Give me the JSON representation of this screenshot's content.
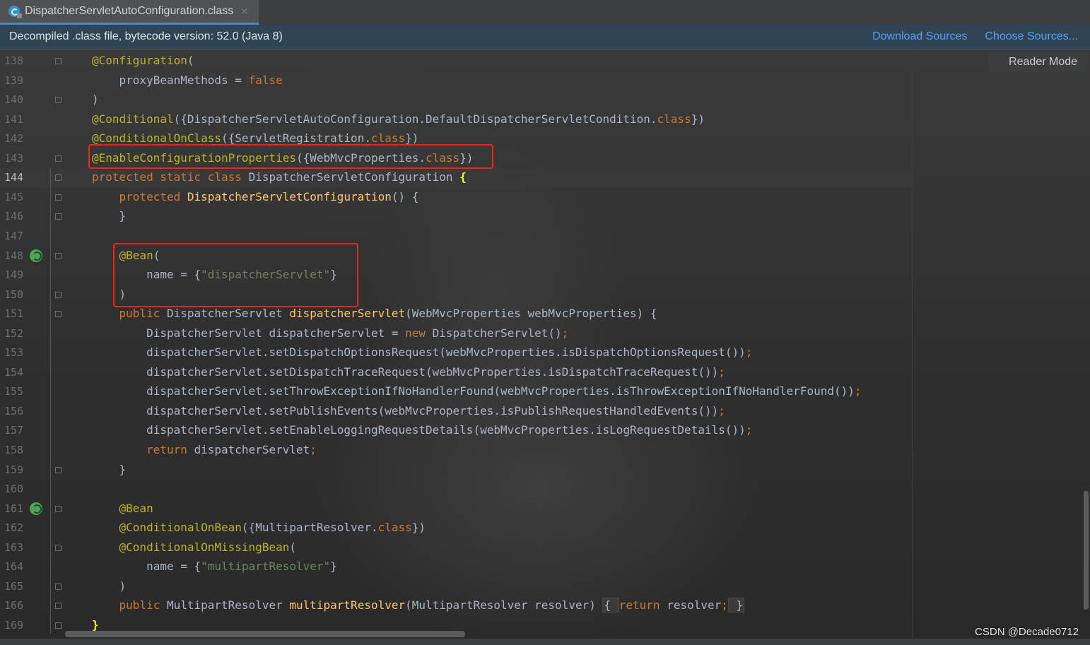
{
  "tab": {
    "title": "DispatcherServletAutoConfiguration.class",
    "close": "×",
    "icon": "java-class-icon"
  },
  "banner": {
    "message": "Decompiled .class file, bytecode version: 52.0 (Java 8)",
    "download_sources": "Download Sources",
    "choose_sources": "Choose Sources..."
  },
  "reader_mode": "Reader Mode",
  "watermark": "CSDN @Decade0712",
  "colors": {
    "annotation": "#bbb529",
    "keyword": "#cc7832",
    "string": "#6a8759",
    "function": "#ffc66d",
    "plain": "#a9b7c6",
    "highlight_box": "#e8261f"
  },
  "editor": {
    "current_line": "144",
    "line_numbers": [
      "138",
      "139",
      "140",
      "141",
      "142",
      "143",
      "144",
      "145",
      "146",
      "147",
      "148",
      "149",
      "150",
      "151",
      "152",
      "153",
      "154",
      "155",
      "156",
      "157",
      "158",
      "159",
      "160",
      "161",
      "162",
      "163",
      "164",
      "165",
      "166",
      "169"
    ],
    "lines": [
      [
        {
          "t": "@Configuration",
          "c": "ann"
        },
        {
          "t": "(",
          "c": "pl"
        }
      ],
      [
        {
          "t": "    proxyBeanMethods = ",
          "c": "pl"
        },
        {
          "t": "false",
          "c": "kw"
        }
      ],
      [
        {
          "t": ")",
          "c": "pl"
        }
      ],
      [
        {
          "t": "@Conditional",
          "c": "ann"
        },
        {
          "t": "({DispatcherServletAutoConfiguration.DefaultDispatcherServletCondition.",
          "c": "pl"
        },
        {
          "t": "class",
          "c": "kw"
        },
        {
          "t": "})",
          "c": "pl"
        }
      ],
      [
        {
          "t": "@ConditionalOnClass",
          "c": "ann"
        },
        {
          "t": "({ServletRegistration.",
          "c": "pl"
        },
        {
          "t": "class",
          "c": "kw"
        },
        {
          "t": "})",
          "c": "pl"
        }
      ],
      [
        {
          "t": "@EnableConfigurationProperties",
          "c": "ann"
        },
        {
          "t": "({WebMvcProperties.",
          "c": "pl"
        },
        {
          "t": "class",
          "c": "kw"
        },
        {
          "t": "})",
          "c": "pl"
        }
      ],
      [
        {
          "t": "protected static class ",
          "c": "kw"
        },
        {
          "t": "DispatcherServletConfiguration ",
          "c": "pl"
        },
        {
          "t": "{",
          "c": "brace-hl"
        }
      ],
      [
        {
          "t": "    protected ",
          "c": "kw"
        },
        {
          "t": "DispatcherServletConfiguration",
          "c": "fn"
        },
        {
          "t": "() {",
          "c": "pl"
        }
      ],
      [
        {
          "t": "    }",
          "c": "pl"
        }
      ],
      [],
      [
        {
          "t": "    @Bean",
          "c": "ann"
        },
        {
          "t": "(",
          "c": "pl"
        }
      ],
      [
        {
          "t": "        name = {",
          "c": "pl"
        },
        {
          "t": "\"dispatcherServlet\"",
          "c": "str"
        },
        {
          "t": "}",
          "c": "pl"
        }
      ],
      [
        {
          "t": "    )",
          "c": "pl"
        }
      ],
      [
        {
          "t": "    public ",
          "c": "kw"
        },
        {
          "t": "DispatcherServlet ",
          "c": "pl"
        },
        {
          "t": "dispatcherServlet",
          "c": "fn"
        },
        {
          "t": "(WebMvcProperties webMvcProperties) {",
          "c": "pl"
        }
      ],
      [
        {
          "t": "        DispatcherServlet dispatcherServlet = ",
          "c": "pl"
        },
        {
          "t": "new ",
          "c": "kw"
        },
        {
          "t": "DispatcherServlet()",
          "c": "pl"
        },
        {
          "t": ";",
          "c": "kw"
        }
      ],
      [
        {
          "t": "        dispatcherServlet.setDispatchOptionsRequest(webMvcProperties.isDispatchOptionsRequest())",
          "c": "pl"
        },
        {
          "t": ";",
          "c": "kw"
        }
      ],
      [
        {
          "t": "        dispatcherServlet.setDispatchTraceRequest(webMvcProperties.isDispatchTraceRequest())",
          "c": "pl"
        },
        {
          "t": ";",
          "c": "kw"
        }
      ],
      [
        {
          "t": "        dispatcherServlet.setThrowExceptionIfNoHandlerFound(webMvcProperties.isThrowExceptionIfNoHandlerFound())",
          "c": "pl"
        },
        {
          "t": ";",
          "c": "kw"
        }
      ],
      [
        {
          "t": "        dispatcherServlet.setPublishEvents(webMvcProperties.isPublishRequestHandledEvents())",
          "c": "pl"
        },
        {
          "t": ";",
          "c": "kw"
        }
      ],
      [
        {
          "t": "        dispatcherServlet.setEnableLoggingRequestDetails(webMvcProperties.isLogRequestDetails())",
          "c": "pl"
        },
        {
          "t": ";",
          "c": "kw"
        }
      ],
      [
        {
          "t": "        return ",
          "c": "kw"
        },
        {
          "t": "dispatcherServlet",
          "c": "pl"
        },
        {
          "t": ";",
          "c": "kw"
        }
      ],
      [
        {
          "t": "    }",
          "c": "pl"
        }
      ],
      [],
      [
        {
          "t": "    @Bean",
          "c": "ann"
        }
      ],
      [
        {
          "t": "    @ConditionalOnBean",
          "c": "ann"
        },
        {
          "t": "({MultipartResolver.",
          "c": "pl"
        },
        {
          "t": "class",
          "c": "kw"
        },
        {
          "t": "})",
          "c": "pl"
        }
      ],
      [
        {
          "t": "    @ConditionalOnMissingBean",
          "c": "ann"
        },
        {
          "t": "(",
          "c": "pl"
        }
      ],
      [
        {
          "t": "        name = {",
          "c": "pl"
        },
        {
          "t": "\"multipartResolver\"",
          "c": "str"
        },
        {
          "t": "}",
          "c": "pl"
        }
      ],
      [
        {
          "t": "    )",
          "c": "pl"
        }
      ],
      [
        {
          "t": "    public ",
          "c": "kw"
        },
        {
          "t": "MultipartResolver ",
          "c": "pl"
        },
        {
          "t": "multipartResolver",
          "c": "fn"
        },
        {
          "t": "(MultipartResolver resolver) ",
          "c": "pl"
        },
        {
          "t": "{ ",
          "c": "fold"
        },
        {
          "t": "return ",
          "c": "kw"
        },
        {
          "t": "resolver",
          "c": "pl"
        },
        {
          "t": ";",
          "c": "kw"
        },
        {
          "t": " }",
          "c": "fold"
        }
      ],
      [
        {
          "t": "}",
          "c": "brace-hl"
        }
      ]
    ]
  }
}
